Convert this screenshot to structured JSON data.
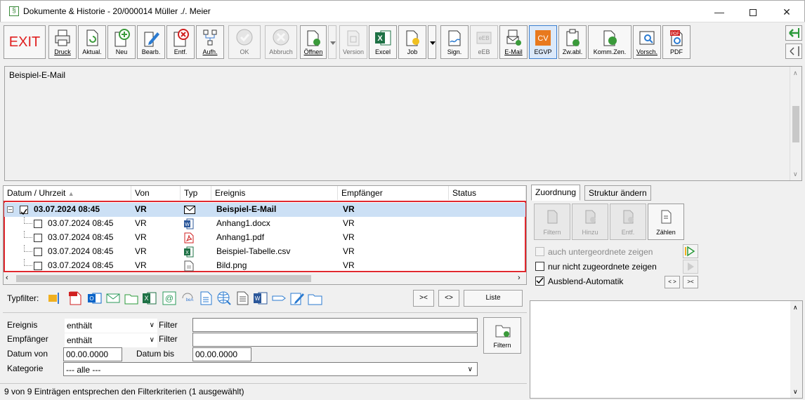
{
  "window": {
    "title": "Dokumente & Historie - 20/000014 Müller ./. Meier",
    "app_icon_glyph": "§"
  },
  "toolbar": {
    "exit_label": "EXIT",
    "buttons": [
      {
        "name": "druck",
        "label": "Druck",
        "icon": "printer-icon"
      },
      {
        "name": "aktual",
        "label": "Aktual.",
        "icon": "refresh-icon"
      },
      {
        "name": "neu",
        "label": "Neu",
        "icon": "plus-icon"
      },
      {
        "name": "bearb",
        "label": "Bearb.",
        "icon": "edit-icon"
      },
      {
        "name": "entf",
        "label": "Entf.",
        "icon": "delete-icon"
      },
      {
        "name": "aufh",
        "label": "Aufh.",
        "icon": "tree-icon"
      },
      {
        "name": "ok",
        "label": "OK",
        "icon": "check-icon",
        "disabled": true
      },
      {
        "name": "abbruch",
        "label": "Abbruch",
        "icon": "cancel-icon",
        "disabled": true
      },
      {
        "name": "oeffnen",
        "label": "Öffnen",
        "icon": "open-icon"
      },
      {
        "name": "version",
        "label": "Version",
        "icon": "version-icon",
        "disabled": true
      },
      {
        "name": "excel",
        "label": "Excel",
        "icon": "excel-icon"
      },
      {
        "name": "job",
        "label": "Job",
        "icon": "job-icon"
      },
      {
        "name": "sign",
        "label": "Sign.",
        "icon": "sign-icon"
      },
      {
        "name": "eeb",
        "label": "eEB",
        "icon": "eeb-icon",
        "disabled": true
      },
      {
        "name": "email",
        "label": "E-Mail",
        "icon": "email-icon"
      },
      {
        "name": "egvp",
        "label": "EGVP",
        "icon": "egvp-icon",
        "selected": true
      },
      {
        "name": "zwabl",
        "label": "Zw.abl.",
        "icon": "clipboard-icon"
      },
      {
        "name": "kommzen",
        "label": "Komm.Zen.",
        "icon": "kommzen-icon"
      },
      {
        "name": "vorsch",
        "label": "Vorsch.",
        "icon": "preview-icon"
      },
      {
        "name": "pdf",
        "label": "PDF",
        "icon": "pdf-icon"
      }
    ]
  },
  "email": {
    "text": "Beispiel-E-Mail"
  },
  "table": {
    "headers": [
      "Datum / Uhrzeit",
      "Von",
      "Typ",
      "Ereignis",
      "Empfänger",
      "Status"
    ],
    "rows": [
      {
        "date": "03.07.2024  08:45",
        "von": "VR",
        "typ": "mail",
        "ereignis": "Beispiel-E-Mail",
        "empf": "VR",
        "checked": true,
        "parent": true
      },
      {
        "date": "03.07.2024  08:45",
        "von": "VR",
        "typ": "word",
        "ereignis": "Anhang1.docx",
        "empf": "VR",
        "checked": false
      },
      {
        "date": "03.07.2024  08:45",
        "von": "VR",
        "typ": "pdf",
        "ereignis": "Anhang1.pdf",
        "empf": "VR",
        "checked": false
      },
      {
        "date": "03.07.2024  08:45",
        "von": "VR",
        "typ": "excel",
        "ereignis": "Beispiel-Tabelle.csv",
        "empf": "VR",
        "checked": false
      },
      {
        "date": "03.07.2024  08:45",
        "von": "VR",
        "typ": "image",
        "ereignis": "Bild.png",
        "empf": "VR",
        "checked": false
      }
    ]
  },
  "typfilter": {
    "label": "Typfilter:",
    "btn_collapse": "><",
    "btn_expand": "<>",
    "btn_liste": "Liste"
  },
  "filter": {
    "ereignis_label": "Ereignis",
    "ereignis_op": "enthält",
    "ereignis_filter_label": "Filter",
    "ereignis_value": "",
    "empf_label": "Empfänger",
    "empf_op": "enthält",
    "empf_filter_label": "Filter",
    "empf_value": "",
    "datum_von_label": "Datum von",
    "datum_von": "00.00.0000",
    "datum_bis_label": "Datum bis",
    "datum_bis": "00.00.0000",
    "kategorie_label": "Kategorie",
    "kategorie": "--- alle ---",
    "filtern_label": "Filtern"
  },
  "status": {
    "text": "9 von 9 Einträgen entsprechen den Filterkriterien (1 ausgewählt)"
  },
  "right": {
    "tab1": "Zuordnung",
    "tab2": "Struktur ändern",
    "btn_filtern": "Filtern",
    "btn_hinzu": "Hinzu",
    "btn_entf": "Entf.",
    "btn_zaehlen": "Zählen",
    "opt1": "auch untergeordnete zeigen",
    "opt2": "nur nicht zugeordnete zeigen",
    "opt3": "Ausblend-Automatik",
    "opt3_checked": true,
    "nav_lr": "< >",
    "nav_rl": ">< "
  },
  "colors": {
    "selection": "#cce0f5",
    "highlight_border": "#e0282e",
    "exit_red": "#e02020"
  }
}
